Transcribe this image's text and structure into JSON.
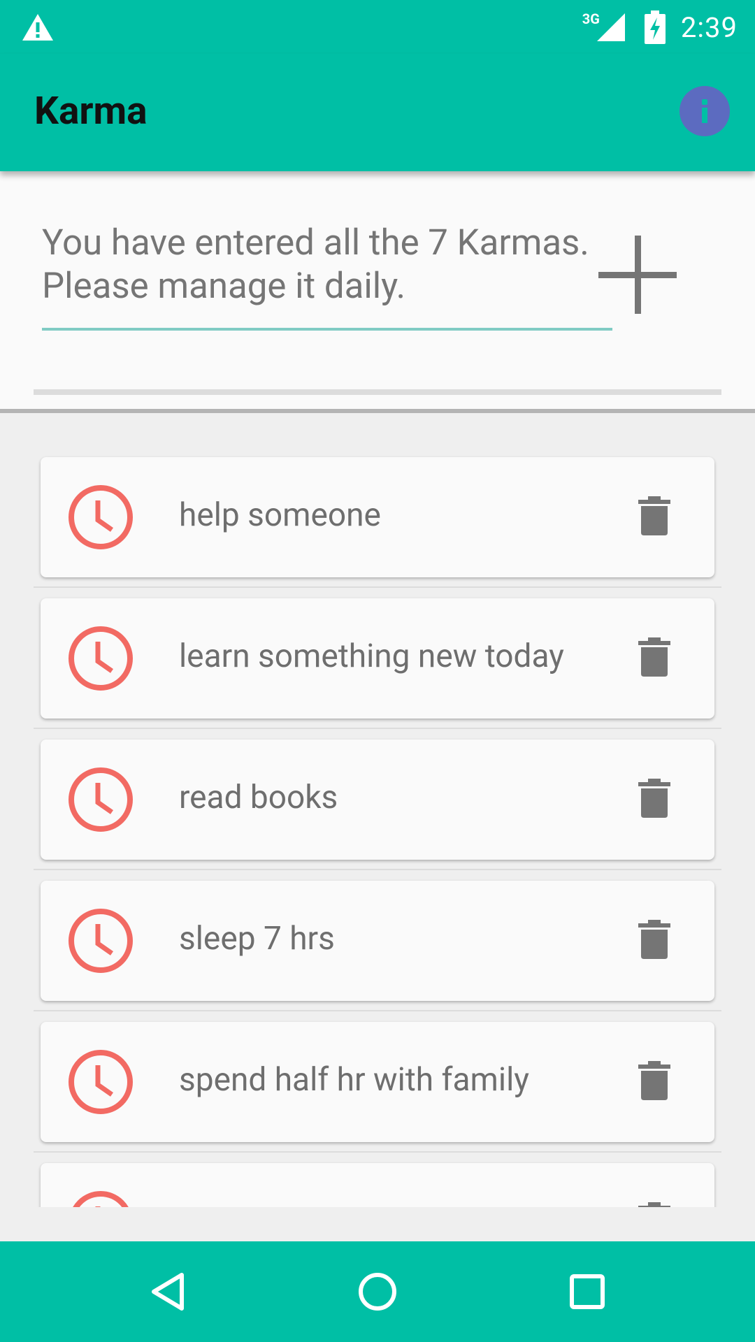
{
  "status_bar": {
    "network_type": "3G",
    "time": "2:39",
    "icons": [
      "warning-icon",
      "signal-icon",
      "battery-charging-icon"
    ]
  },
  "app_bar": {
    "title": "Karma",
    "info_icon": "info-icon",
    "colors": {
      "primary": "#00bfa5",
      "info_bg": "#5c6bc0"
    }
  },
  "input_panel": {
    "message": "You have entered all the 7 Karmas. Please manage it daily.",
    "add_icon": "plus-icon"
  },
  "karmas": [
    {
      "label": "help someone"
    },
    {
      "label": "learn something new today"
    },
    {
      "label": "read books"
    },
    {
      "label": "sleep 7 hrs"
    },
    {
      "label": "spend half hr with family"
    },
    {
      "label": ""
    }
  ],
  "item_icons": {
    "leading": "alarm-clock-icon",
    "trailing": "trash-icon",
    "alarm_color": "#f26a63"
  },
  "nav_bar": {
    "buttons": [
      "back-icon",
      "home-icon",
      "recents-icon"
    ]
  }
}
